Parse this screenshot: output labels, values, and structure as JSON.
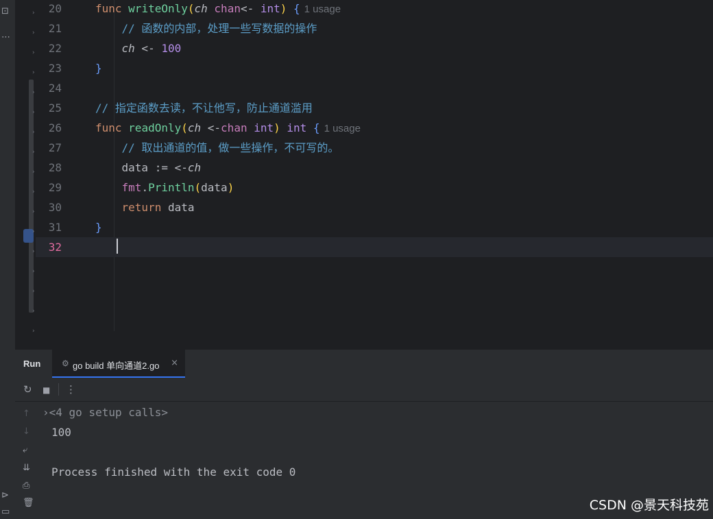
{
  "editor": {
    "lines": [
      {
        "n": "20",
        "segs": [
          {
            "t": "func ",
            "c": "kw"
          },
          {
            "t": "writeOnly",
            "c": "fn2"
          },
          {
            "t": "(",
            "c": "br1"
          },
          {
            "t": "ch ",
            "c": "param"
          },
          {
            "t": "chan",
            "c": "pkg"
          },
          {
            "t": "<- ",
            "c": "plain"
          },
          {
            "t": "int",
            "c": "type"
          },
          {
            "t": ")",
            "c": "br1"
          },
          {
            "t": " {",
            "c": "br2"
          }
        ],
        "hint": "1 usage"
      },
      {
        "n": "21",
        "segs": [
          {
            "t": "    // 函数的内部，处理一些写数据的操作",
            "c": "cm"
          }
        ]
      },
      {
        "n": "22",
        "segs": [
          {
            "t": "    ",
            "c": "plain"
          },
          {
            "t": "ch",
            "c": "param"
          },
          {
            "t": " <- ",
            "c": "plain"
          },
          {
            "t": "100",
            "c": "type"
          }
        ]
      },
      {
        "n": "23",
        "segs": [
          {
            "t": "}",
            "c": "br2"
          }
        ]
      },
      {
        "n": "24",
        "segs": []
      },
      {
        "n": "25",
        "segs": [
          {
            "t": "// 指定函数去读，不让他写，防止通道滥用",
            "c": "cm"
          }
        ]
      },
      {
        "n": "26",
        "segs": [
          {
            "t": "func ",
            "c": "kw"
          },
          {
            "t": "readOnly",
            "c": "fn2"
          },
          {
            "t": "(",
            "c": "br1"
          },
          {
            "t": "ch ",
            "c": "param"
          },
          {
            "t": "<-",
            "c": "plain"
          },
          {
            "t": "chan ",
            "c": "pkg"
          },
          {
            "t": "int",
            "c": "type"
          },
          {
            "t": ")",
            "c": "br1"
          },
          {
            "t": " int",
            "c": "type"
          },
          {
            "t": " {",
            "c": "br2"
          }
        ],
        "hint": "1 usage"
      },
      {
        "n": "27",
        "segs": [
          {
            "t": "    // 取出通道的值，做一些操作，不可写的。",
            "c": "cm"
          }
        ]
      },
      {
        "n": "28",
        "segs": [
          {
            "t": "    data := <-",
            "c": "plain"
          },
          {
            "t": "ch",
            "c": "param"
          }
        ]
      },
      {
        "n": "29",
        "segs": [
          {
            "t": "    ",
            "c": "plain"
          },
          {
            "t": "fmt",
            "c": "pkg"
          },
          {
            "t": ".",
            "c": "plain"
          },
          {
            "t": "Println",
            "c": "fn2"
          },
          {
            "t": "(",
            "c": "br1"
          },
          {
            "t": "data",
            "c": "plain"
          },
          {
            "t": ")",
            "c": "br1"
          }
        ]
      },
      {
        "n": "30",
        "segs": [
          {
            "t": "    ",
            "c": "plain"
          },
          {
            "t": "return",
            "c": "kw"
          },
          {
            "t": " data",
            "c": "plain"
          }
        ]
      },
      {
        "n": "31",
        "segs": [
          {
            "t": "}",
            "c": "br2"
          }
        ]
      },
      {
        "n": "32",
        "segs": [],
        "current": true
      }
    ]
  },
  "run_panel": {
    "title": "Run",
    "tab_label": "go build 单向通道2.go",
    "tab_close": "×",
    "console": {
      "setup_line": "<4 go setup calls>",
      "output_line": "100",
      "finish_line": "Process finished with the exit code 0"
    }
  },
  "icons": {
    "rerun": "rerun-icon",
    "stop": "stop-icon",
    "more": "more-vertical-icon"
  },
  "watermark": "CSDN @景天科技苑"
}
